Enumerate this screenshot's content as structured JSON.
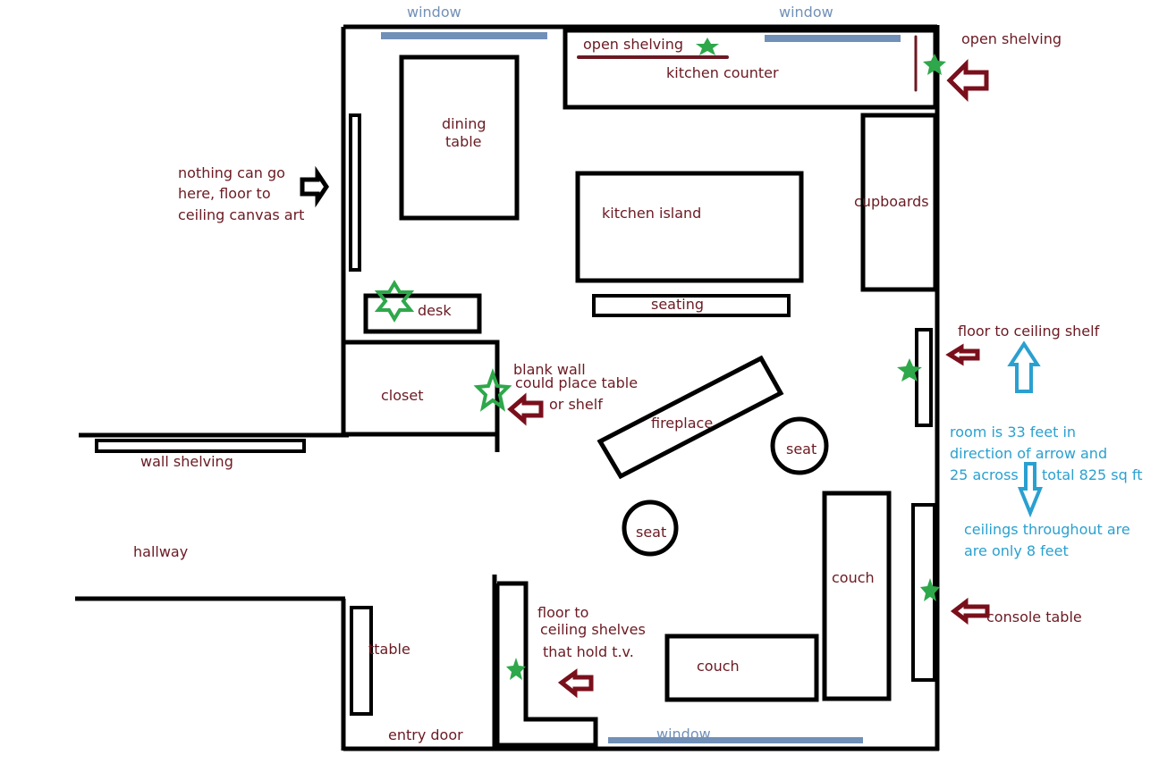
{
  "diagram": {
    "type": "floor-plan",
    "room_labels": {
      "dining_table_line1": "dining",
      "dining_table_line2": "table",
      "kitchen_counter": "kitchen counter",
      "open_shelving_counter": "open shelving",
      "kitchen_island": "kitchen island",
      "cupboards": "cupboards",
      "seating": "seating",
      "desk": "desk",
      "closet": "closet",
      "fireplace": "fireplace",
      "seat_1": "seat",
      "seat_2": "seat",
      "couch_1": "couch",
      "couch_2": "couch",
      "table": "ttable",
      "entry_door": "entry door",
      "wall_shelving": "wall shelving",
      "hallway": "hallway"
    },
    "windows": {
      "top_left": "window",
      "top_right": "window",
      "bottom": "window"
    },
    "annotations": {
      "open_shelving_right": "open shelving",
      "canvas_art": [
        "nothing can go",
        "here, floor to",
        "ceiling canvas art"
      ],
      "blank_wall": [
        "blank wall",
        "could place table",
        "or shelf"
      ],
      "floor_ceiling_shelf": "floor to ceiling shelf",
      "room_size": [
        "room is 33 feet in",
        "direction of arrow and",
        "25 across",
        "total 825 sq ft"
      ],
      "ceilings": [
        "ceilings throughout are",
        "are only 8 feet"
      ],
      "console_table": "console table",
      "tv_shelves": [
        "floor to",
        "ceiling shelves",
        "that hold t.v."
      ]
    },
    "measurements": {
      "length_ft": 33,
      "width_ft": 25,
      "area_sq_ft": 825,
      "ceiling_height_ft": 8
    },
    "colors": {
      "label": "#6b1a22",
      "note_blue": "#2aa0d0",
      "window": "#7190b8",
      "star": "#2ea84a",
      "arrow": "#7a0f1c"
    }
  }
}
